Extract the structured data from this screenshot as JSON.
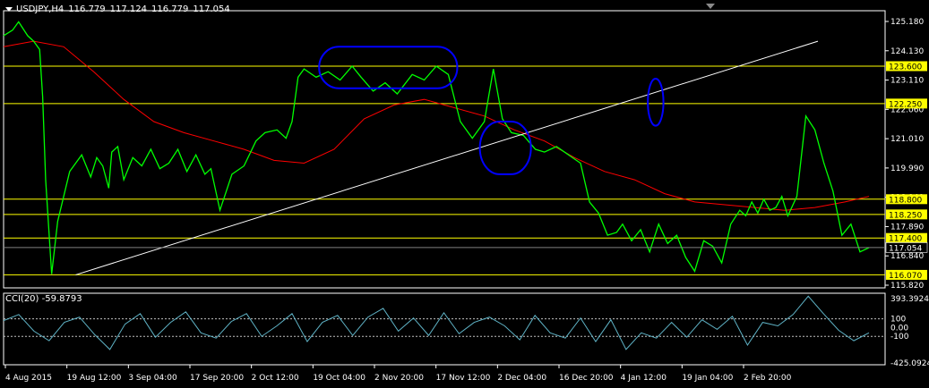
{
  "header": {
    "symbol_timeframe": "USDJPY,H4",
    "open": "116.779",
    "high": "117.124",
    "low": "116.779",
    "close": "117.054"
  },
  "indicator": {
    "label": "CCI(20) -59.8793"
  },
  "colors": {
    "background": "#000000",
    "axis": "#ffffff",
    "price": "#00ff00",
    "moving_average": "#ff0000",
    "level_line": "#ffff00",
    "level_label_bg": "#ffff00",
    "trendline": "#ffffff",
    "annotation": "#0000ff",
    "cci_line": "#5fb3c6",
    "cci_level": "#c0c0c0"
  },
  "chart_data": {
    "type": "line",
    "symbol": "USDJPY",
    "timeframe": "H4",
    "x_tick_labels": [
      "4 Aug 2015",
      "19 Aug 12:00",
      "3 Sep 04:00",
      "17 Sep 20:00",
      "2 Oct 12:00",
      "19 Oct 04:00",
      "2 Nov 20:00",
      "17 Nov 12:00",
      "2 Dec 04:00",
      "16 Dec 20:00",
      "4 Jan 12:00",
      "19 Jan 04:00",
      "2 Feb 20:00"
    ],
    "y_tick_labels": [
      "125.180",
      "124.130",
      "123.110",
      "122.060",
      "121.010",
      "119.990",
      "118.940",
      "117.890",
      "116.840",
      "115.820"
    ],
    "ylim": [
      115.6,
      125.6
    ],
    "horizontal_levels": [
      {
        "label": "123.600",
        "value": 123.6
      },
      {
        "label": "122.250",
        "value": 122.25
      },
      {
        "label": "118.800",
        "value": 118.8
      },
      {
        "label": "118.250",
        "value": 118.25
      },
      {
        "label": "117.400",
        "value": 117.4
      },
      {
        "label": "116.070",
        "value": 116.07
      }
    ],
    "current_price": {
      "label": "117.054",
      "value": 117.054
    },
    "series": [
      {
        "kind": "price",
        "x": [
          0,
          3,
          5,
          8,
          10,
          12,
          13,
          14,
          16,
          18,
          22,
          26,
          29,
          31,
          33,
          35,
          36,
          38,
          40,
          43,
          46,
          49,
          52,
          55,
          58,
          61,
          64,
          67,
          69,
          72,
          76,
          80,
          84,
          87,
          91,
          94,
          96,
          98,
          100,
          104,
          108,
          112,
          116,
          119,
          123,
          127,
          131,
          136,
          140,
          144,
          148,
          152,
          156,
          160,
          163,
          166,
          169,
          173,
          177,
          180,
          184,
          188,
          192,
          195,
          198,
          201,
          204,
          206,
          209,
          212,
          215,
          218,
          221,
          224,
          227,
          230,
          233,
          236,
          239,
          242,
          245,
          247,
          249,
          251,
          253,
          255,
          257,
          259,
          261,
          264,
          267,
          270,
          273,
          276,
          279,
          282,
          285,
          288
        ],
        "values": [
          124.7,
          124.9,
          125.2,
          124.7,
          124.5,
          124.2,
          122.5,
          119.5,
          116.1,
          118.0,
          119.8,
          120.4,
          119.6,
          120.3,
          120.0,
          119.2,
          120.5,
          120.7,
          119.5,
          120.3,
          120.0,
          120.6,
          119.9,
          120.1,
          120.6,
          119.8,
          120.4,
          119.7,
          119.9,
          118.4,
          119.7,
          120.0,
          120.9,
          121.2,
          121.3,
          121.0,
          121.6,
          123.2,
          123.5,
          123.2,
          123.4,
          123.1,
          123.6,
          123.2,
          122.7,
          123.0,
          122.6,
          123.3,
          123.1,
          123.6,
          123.3,
          121.6,
          121.0,
          121.6,
          123.5,
          121.7,
          121.2,
          121.1,
          120.6,
          120.5,
          120.7,
          120.4,
          120.1,
          118.7,
          118.3,
          117.5,
          117.6,
          117.9,
          117.3,
          117.7,
          116.9,
          117.9,
          117.2,
          117.5,
          116.7,
          116.2,
          117.3,
          117.1,
          116.5,
          117.9,
          118.4,
          118.2,
          118.7,
          118.3,
          118.8,
          118.4,
          118.5,
          118.9,
          118.2,
          118.9,
          121.8,
          121.3,
          120.1,
          119.1,
          117.5,
          117.9,
          116.9,
          117.05
        ]
      },
      {
        "kind": "moving_average",
        "x": [
          0,
          10,
          20,
          30,
          40,
          50,
          60,
          70,
          80,
          90,
          100,
          110,
          120,
          130,
          140,
          150,
          160,
          170,
          180,
          190,
          200,
          210,
          220,
          230,
          240,
          250,
          260,
          270,
          280,
          288
        ],
        "values": [
          124.3,
          124.5,
          124.3,
          123.4,
          122.4,
          121.6,
          121.2,
          120.9,
          120.6,
          120.2,
          120.1,
          120.6,
          121.7,
          122.2,
          122.4,
          122.1,
          121.8,
          121.3,
          120.9,
          120.3,
          119.8,
          119.5,
          119.0,
          118.7,
          118.6,
          118.5,
          118.4,
          118.5,
          118.7,
          118.9
        ]
      }
    ],
    "trendline": {
      "x": [
        24,
        271
      ],
      "values": [
        116.07,
        124.5
      ]
    },
    "annotations": [
      {
        "shape": "ellipse",
        "cx": 128,
        "cy": 123.55,
        "rx": 23,
        "ry": 0.75
      },
      {
        "shape": "ellipse",
        "cx": 167,
        "cy": 120.65,
        "rx": 8.5,
        "ry": 0.95
      },
      {
        "shape": "ellipse",
        "cx": 217,
        "cy": 122.3,
        "rx": 2.6,
        "ry": 0.85
      }
    ],
    "cci": {
      "name": "CCI(20)",
      "current": -59.8793,
      "y_tick_labels": [
        "393.3924",
        "100",
        "0.00",
        "-100",
        "-425.0924"
      ],
      "ylim": [
        -425.0924,
        393.3924
      ],
      "levels": [
        100,
        -100
      ],
      "x": [
        0,
        4,
        8,
        12,
        16,
        20,
        24,
        28,
        32,
        36,
        40,
        44,
        48,
        52,
        56,
        60,
        64,
        68,
        72,
        76,
        80,
        84,
        88,
        92,
        96,
        100,
        104,
        108,
        112,
        116,
        120,
        124,
        128,
        132,
        136,
        140,
        144,
        148,
        152,
        156,
        160,
        164,
        168,
        172,
        176,
        180,
        184,
        188,
        192,
        196,
        200,
        204,
        208,
        212,
        216,
        220,
        224,
        228
      ],
      "values": [
        80,
        150,
        -40,
        -150,
        60,
        120,
        -80,
        -250,
        40,
        160,
        -110,
        60,
        180,
        -60,
        -120,
        70,
        160,
        -100,
        20,
        160,
        -160,
        60,
        140,
        -90,
        120,
        220,
        -40,
        110,
        -90,
        170,
        -70,
        60,
        120,
        20,
        -140,
        140,
        -60,
        -120,
        110,
        -160,
        90,
        -250,
        -60,
        -120,
        60,
        -110,
        90,
        -20,
        130,
        -200,
        60,
        20,
        150,
        360,
        160,
        -30,
        -150,
        -60
      ]
    }
  }
}
